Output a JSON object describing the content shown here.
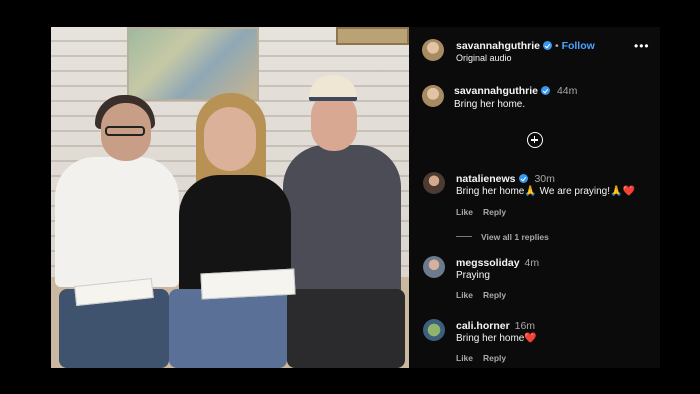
{
  "header": {
    "username": "savannahguthrie",
    "follow_label": "Follow",
    "audio_label": "Original audio",
    "more_icon": "more-horizontal-icon"
  },
  "caption": {
    "username": "savannahguthrie",
    "time": "44m",
    "text": "Bring her home."
  },
  "comments": [
    {
      "username": "natalienews",
      "verified": true,
      "time": "30m",
      "text": "Bring her home🙏 We are praying!🙏❤️",
      "like": "Like",
      "reply": "Reply",
      "view_replies": "View all 1 replies"
    },
    {
      "username": "megssoliday",
      "verified": false,
      "time": "4m",
      "text": "Praying",
      "like": "Like",
      "reply": "Reply"
    },
    {
      "username": "cali.horner",
      "verified": false,
      "time": "16m",
      "text": "Bring her home❤️",
      "like": "Like",
      "reply": "Reply"
    }
  ],
  "colors": {
    "background": "#000000",
    "panel": "#0b0b0b",
    "verified": "#3897f0",
    "follow": "#4ca3ff",
    "muted": "#a8a8a8"
  },
  "icons": [
    "verified-badge-icon",
    "more-horizontal-icon",
    "add-comment-icon"
  ]
}
